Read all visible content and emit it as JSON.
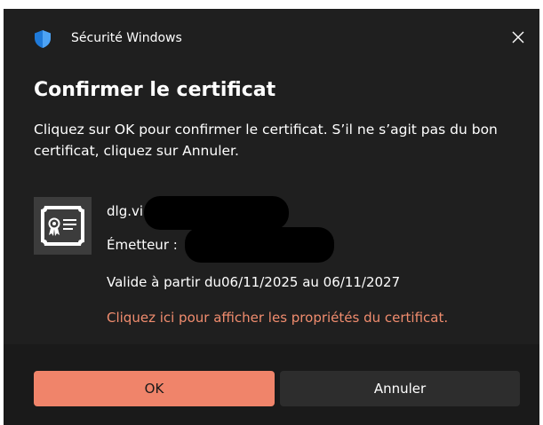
{
  "window": {
    "app_title": "Sécurité Windows",
    "shield_icon": "windows-security-shield-icon",
    "close_icon": "close-icon",
    "accent_color": "#f0846a",
    "background_color": "#1f1f1f"
  },
  "content": {
    "heading": "Confirmer le certificat",
    "description": "Cliquez sur OK pour confirmer le certificat. S’il ne s’agit pas du bon certificat, cliquez sur Annuler.",
    "certificate_icon": "certificate-icon",
    "name_prefix": "dlg.vi",
    "issuer_label": "Émetteur :",
    "validity": "Valide à partir du06/11/2025 au 06/11/2027",
    "properties_link": "Cliquez ici pour afficher les propriétés du certificat.",
    "link_color": "#f08c6e"
  },
  "footer": {
    "ok_label": "OK",
    "cancel_label": "Annuler"
  }
}
